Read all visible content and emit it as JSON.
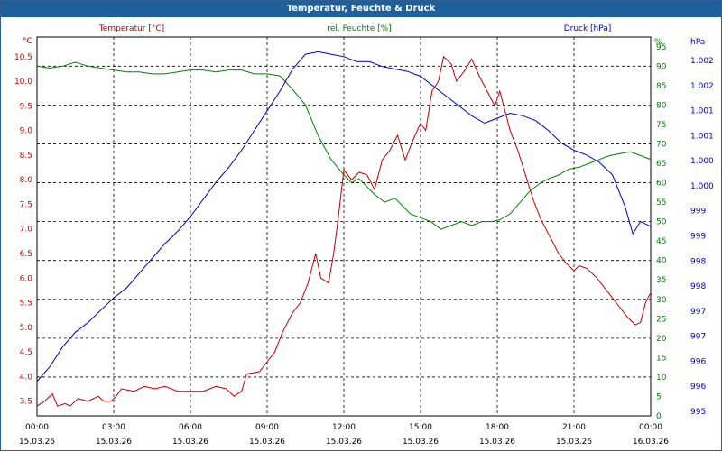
{
  "window": {
    "title": "Temperatur, Feuchte & Druck"
  },
  "chart_data": {
    "type": "line",
    "title": "Temperatur, Feuchte & Druck",
    "grid": true,
    "colors": {
      "temperature": "#c00000",
      "humidity": "#008000",
      "pressure": "#0000c0",
      "grid": "#000000"
    },
    "x_ticks": [
      {
        "time": "00:00",
        "date": "15.03.26"
      },
      {
        "time": "03:00",
        "date": "15.03.26"
      },
      {
        "time": "06:00",
        "date": "15.03.26"
      },
      {
        "time": "09:00",
        "date": "15.03.26"
      },
      {
        "time": "12:00",
        "date": "15.03.26"
      },
      {
        "time": "15:00",
        "date": "15.03.26"
      },
      {
        "time": "18:00",
        "date": "15.03.26"
      },
      {
        "time": "21:00",
        "date": "15.03.26"
      },
      {
        "time": "00:00",
        "date": "16.03.26"
      }
    ],
    "xlim_hours": [
      0,
      24
    ],
    "axes": {
      "temperature": {
        "unit": "°C",
        "label": "Temperatur [°C]",
        "ylim": [
          3.2,
          10.9
        ],
        "ticks": [
          "10.5",
          "10.0",
          "9.5",
          "9.0",
          "8.5",
          "8.0",
          "7.5",
          "7.0",
          "6.5",
          "6.0",
          "5.5",
          "5.0",
          "4.5",
          "4.0",
          "3.5"
        ]
      },
      "humidity": {
        "unit": "%",
        "label": "rel. Feuchte [%]",
        "ylim": [
          0,
          97.5
        ],
        "ticks": [
          "95",
          "90",
          "85",
          "80",
          "75",
          "70",
          "65",
          "60",
          "55",
          "50",
          "45",
          "40",
          "35",
          "30",
          "25",
          "20",
          "15",
          "10",
          "5",
          "0"
        ]
      },
      "pressure": {
        "unit": "hPa",
        "label": "Druck [hPa]",
        "ylim": [
          995.0,
          1002.7
        ],
        "ticks": [
          "1.002",
          "1.002",
          "1.001",
          "1.001",
          "1.000",
          "1.000",
          "999",
          "999",
          "998",
          "998",
          "997",
          "997",
          "996",
          "996",
          "995"
        ]
      }
    },
    "series": [
      {
        "name": "Temperatur [°C]",
        "axis": "temperature",
        "color": "#c00000",
        "points": [
          [
            0,
            3.4
          ],
          [
            0.3,
            3.5
          ],
          [
            0.6,
            3.65
          ],
          [
            0.8,
            3.4
          ],
          [
            1.1,
            3.45
          ],
          [
            1.3,
            3.4
          ],
          [
            1.6,
            3.55
          ],
          [
            2.0,
            3.5
          ],
          [
            2.4,
            3.6
          ],
          [
            2.6,
            3.5
          ],
          [
            2.9,
            3.5
          ],
          [
            3.1,
            3.6
          ],
          [
            3.3,
            3.75
          ],
          [
            3.8,
            3.7
          ],
          [
            4.2,
            3.8
          ],
          [
            4.6,
            3.75
          ],
          [
            5.0,
            3.8
          ],
          [
            5.5,
            3.7
          ],
          [
            6.0,
            3.7
          ],
          [
            6.5,
            3.7
          ],
          [
            7.0,
            3.8
          ],
          [
            7.4,
            3.75
          ],
          [
            7.7,
            3.6
          ],
          [
            8.0,
            3.7
          ],
          [
            8.2,
            4.05
          ],
          [
            8.7,
            4.1
          ],
          [
            9.0,
            4.3
          ],
          [
            9.3,
            4.5
          ],
          [
            9.6,
            4.9
          ],
          [
            10.0,
            5.3
          ],
          [
            10.3,
            5.5
          ],
          [
            10.6,
            5.9
          ],
          [
            10.9,
            6.5
          ],
          [
            11.1,
            6.0
          ],
          [
            11.4,
            5.9
          ],
          [
            11.6,
            6.5
          ],
          [
            11.8,
            7.3
          ],
          [
            12.0,
            8.2
          ],
          [
            12.3,
            8.0
          ],
          [
            12.6,
            8.15
          ],
          [
            12.9,
            8.1
          ],
          [
            13.2,
            7.8
          ],
          [
            13.5,
            8.4
          ],
          [
            13.8,
            8.6
          ],
          [
            14.1,
            8.9
          ],
          [
            14.4,
            8.4
          ],
          [
            14.7,
            8.8
          ],
          [
            15.0,
            9.15
          ],
          [
            15.2,
            9.0
          ],
          [
            15.45,
            9.8
          ],
          [
            15.7,
            10.0
          ],
          [
            15.9,
            10.5
          ],
          [
            16.2,
            10.35
          ],
          [
            16.4,
            10.0
          ],
          [
            16.7,
            10.2
          ],
          [
            17.0,
            10.45
          ],
          [
            17.3,
            10.1
          ],
          [
            17.6,
            9.8
          ],
          [
            17.9,
            9.5
          ],
          [
            18.1,
            9.8
          ],
          [
            18.3,
            9.4
          ],
          [
            18.5,
            9.0
          ],
          [
            18.8,
            8.6
          ],
          [
            19.1,
            8.1
          ],
          [
            19.4,
            7.6
          ],
          [
            19.7,
            7.2
          ],
          [
            20.0,
            6.9
          ],
          [
            20.4,
            6.5
          ],
          [
            20.7,
            6.3
          ],
          [
            21.0,
            6.15
          ],
          [
            21.2,
            6.25
          ],
          [
            21.5,
            6.2
          ],
          [
            21.9,
            6.0
          ],
          [
            22.2,
            5.8
          ],
          [
            22.5,
            5.6
          ],
          [
            22.8,
            5.4
          ],
          [
            23.1,
            5.2
          ],
          [
            23.4,
            5.05
          ],
          [
            23.6,
            5.1
          ],
          [
            23.8,
            5.5
          ],
          [
            24.1,
            5.8
          ],
          [
            24.3,
            6.0
          ],
          [
            24.5,
            6.2
          ],
          [
            24.7,
            6.3
          ]
        ]
      },
      {
        "name": "rel. Feuchte [%]",
        "axis": "humidity",
        "color": "#008000",
        "points": [
          [
            0,
            90
          ],
          [
            0.5,
            89.5
          ],
          [
            1.0,
            90
          ],
          [
            1.5,
            91
          ],
          [
            2.0,
            90
          ],
          [
            2.5,
            89.5
          ],
          [
            3.0,
            89
          ],
          [
            3.5,
            88.5
          ],
          [
            4.0,
            88.5
          ],
          [
            4.5,
            88
          ],
          [
            5.0,
            88
          ],
          [
            5.5,
            88.5
          ],
          [
            6.0,
            89
          ],
          [
            6.5,
            89
          ],
          [
            7.0,
            88.5
          ],
          [
            7.5,
            89
          ],
          [
            8.0,
            89
          ],
          [
            8.5,
            88
          ],
          [
            9.0,
            88
          ],
          [
            9.5,
            87.5
          ],
          [
            10.0,
            84
          ],
          [
            10.5,
            80
          ],
          [
            11.0,
            72
          ],
          [
            11.5,
            66
          ],
          [
            12.0,
            62
          ],
          [
            12.3,
            60
          ],
          [
            12.6,
            61
          ],
          [
            12.9,
            59
          ],
          [
            13.2,
            57
          ],
          [
            13.6,
            55
          ],
          [
            14.0,
            56
          ],
          [
            14.3,
            54
          ],
          [
            14.6,
            52
          ],
          [
            15.0,
            51
          ],
          [
            15.4,
            50
          ],
          [
            15.8,
            48
          ],
          [
            16.2,
            49
          ],
          [
            16.6,
            50
          ],
          [
            17.0,
            49
          ],
          [
            17.4,
            50
          ],
          [
            17.8,
            50
          ],
          [
            18.1,
            50.5
          ],
          [
            18.5,
            52
          ],
          [
            18.9,
            55
          ],
          [
            19.3,
            58
          ],
          [
            19.7,
            60
          ],
          [
            20.0,
            61
          ],
          [
            20.4,
            62
          ],
          [
            20.8,
            63.5
          ],
          [
            21.2,
            64
          ],
          [
            21.6,
            65
          ],
          [
            22.0,
            66
          ],
          [
            22.4,
            67
          ],
          [
            22.8,
            67.5
          ],
          [
            23.2,
            68
          ],
          [
            23.6,
            67
          ],
          [
            24.0,
            66
          ],
          [
            24.3,
            66
          ],
          [
            24.7,
            66
          ]
        ]
      },
      {
        "name": "Druck [hPa]",
        "axis": "pressure",
        "color": "#0000c0",
        "points": [
          [
            0,
            995.7
          ],
          [
            0.5,
            996.0
          ],
          [
            1.0,
            996.4
          ],
          [
            1.5,
            996.7
          ],
          [
            2.0,
            996.9
          ],
          [
            2.5,
            997.15
          ],
          [
            3.0,
            997.4
          ],
          [
            3.5,
            997.6
          ],
          [
            4.0,
            997.9
          ],
          [
            4.5,
            998.2
          ],
          [
            5.0,
            998.5
          ],
          [
            5.5,
            998.75
          ],
          [
            6.0,
            999.05
          ],
          [
            6.5,
            999.4
          ],
          [
            7.0,
            999.75
          ],
          [
            7.5,
            1000.05
          ],
          [
            8.0,
            1000.4
          ],
          [
            8.5,
            1000.8
          ],
          [
            9.0,
            1001.2
          ],
          [
            9.5,
            1001.6
          ],
          [
            10.0,
            1002.05
          ],
          [
            10.5,
            1002.35
          ],
          [
            11.0,
            1002.4
          ],
          [
            11.5,
            1002.35
          ],
          [
            12.0,
            1002.3
          ],
          [
            12.5,
            1002.2
          ],
          [
            13.0,
            1002.2
          ],
          [
            13.5,
            1002.1
          ],
          [
            14.0,
            1002.05
          ],
          [
            14.5,
            1002.0
          ],
          [
            15.0,
            1001.9
          ],
          [
            15.5,
            1001.7
          ],
          [
            16.0,
            1001.5
          ],
          [
            16.5,
            1001.3
          ],
          [
            17.0,
            1001.1
          ],
          [
            17.5,
            1000.95
          ],
          [
            18.0,
            1001.05
          ],
          [
            18.5,
            1001.15
          ],
          [
            19.0,
            1001.1
          ],
          [
            19.5,
            1001.0
          ],
          [
            20.0,
            1000.8
          ],
          [
            20.5,
            1000.55
          ],
          [
            21.0,
            1000.4
          ],
          [
            21.5,
            1000.3
          ],
          [
            22.0,
            1000.15
          ],
          [
            22.5,
            999.9
          ],
          [
            23.0,
            999.25
          ],
          [
            23.3,
            998.7
          ],
          [
            23.6,
            998.95
          ],
          [
            24.0,
            998.85
          ],
          [
            24.3,
            998.9
          ],
          [
            24.5,
            998.75
          ],
          [
            24.7,
            998.7
          ]
        ]
      }
    ]
  }
}
